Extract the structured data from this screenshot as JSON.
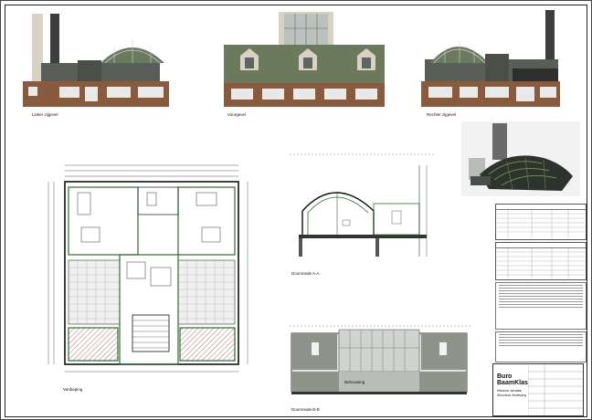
{
  "views": {
    "left_elevation_caption": "Linker zijgevel",
    "front_elevation_caption": "Voorgevel",
    "right_elevation_caption": "Rechter zijgevel",
    "floor_plan_caption": "Verdieping",
    "section_a_caption": "Doorsnede A-A",
    "section_b_caption": "Doorsnede B-B",
    "section_b_room_label": "Bebouwing"
  },
  "title_block": {
    "logo_line1": "Buro",
    "logo_line2": "BaamKlas",
    "project_title": "Nieuwe situatie",
    "project_subtitle": "Woonhuis Verdieping"
  },
  "colors": {
    "brick": "#8a5a3c",
    "roof_green": "#6b7a5c",
    "glass": "#a9b6ae",
    "wall_light": "#d8d2c4",
    "plan_green": "#2e6b2e",
    "plan_hatch": "#b07070"
  }
}
